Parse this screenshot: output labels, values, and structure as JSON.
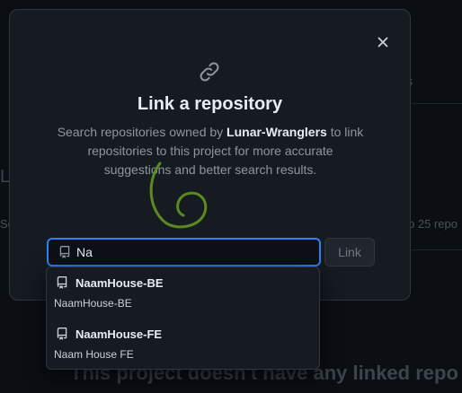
{
  "dialog": {
    "title": "Link a repository",
    "description_prefix": "Search repositories owned by ",
    "owner": "Lunar-Wranglers",
    "description_suffix": " to link repositories to this project for more accurate suggestions and better search results.",
    "close_icon": "close-icon",
    "link_icon": "link-icon"
  },
  "search": {
    "value": "Na",
    "icon": "repo-icon"
  },
  "link_button": {
    "label": "Link"
  },
  "results": [
    {
      "name": "NaamHouse-BE",
      "description": "NaamHouse-BE",
      "icon": "repo-icon"
    },
    {
      "name": "NaamHouse-FE",
      "description": "Naam House FE",
      "icon": "repo-icon"
    }
  ],
  "background": {
    "empty_heading": "This project doesn't have any linked repo",
    "fragment_left": "Li",
    "fragment_right": "p 25 repo",
    "fragment_s": "s",
    "fragment_se": "Se"
  },
  "colors": {
    "accent": "#2f81f7",
    "dialog_bg": "#161b22",
    "border": "#30363d",
    "annotation": "#5c8a1f"
  }
}
